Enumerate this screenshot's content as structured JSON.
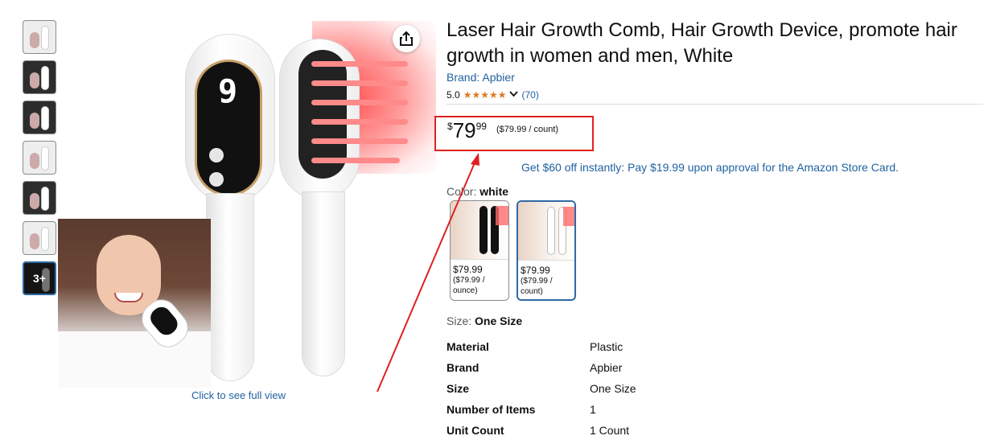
{
  "product": {
    "title": "Laser Hair Growth Comb, Hair Growth Device, promote hair growth in women and men, White",
    "brand": "Brand: Apbier",
    "rating_value": "5.0",
    "stars": "★★★★★",
    "rating_count": "(70)"
  },
  "price": {
    "symbol": "$",
    "whole": "79",
    "fraction": "99",
    "unit": "($79.99 / count)"
  },
  "promo": "Get $60 off instantly: Pay $19.99 upon approval for the Amazon Store Card.",
  "color": {
    "label": "Color: ",
    "value": "white",
    "options": [
      {
        "price": "$79.99",
        "unit": "($79.99 / ounce)"
      },
      {
        "price": "$79.99",
        "unit": "($79.99 / count)"
      }
    ]
  },
  "size": {
    "label": "Size: ",
    "value": "One Size"
  },
  "specs": [
    {
      "key": "Material",
      "value": "Plastic"
    },
    {
      "key": "Brand",
      "value": "Apbier"
    },
    {
      "key": "Size",
      "value": "One Size"
    },
    {
      "key": "Number of Items",
      "value": "1"
    },
    {
      "key": "Unit Count",
      "value": "1 Count"
    }
  ],
  "gallery": {
    "more_label": "3+",
    "full_view": "Click to see full view"
  },
  "device_display": "9",
  "colors": {
    "link": "#2162a1",
    "star": "#de7921",
    "highlight": "#e02020",
    "selected": "#2e6aa6"
  },
  "icons": {
    "share": "share-icon",
    "chevron": "chevron-down-icon"
  }
}
